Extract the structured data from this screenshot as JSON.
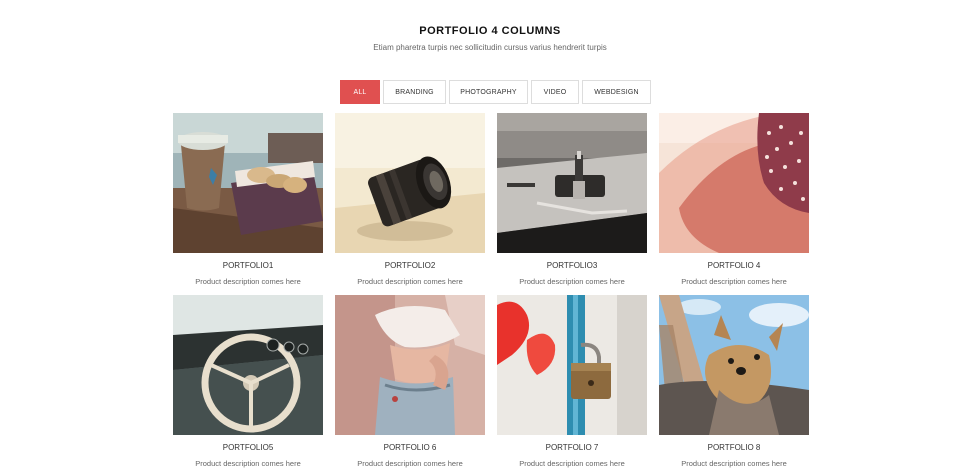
{
  "header": {
    "title": "PORTFOLIO 4 COLUMNS",
    "subtitle": "Etiam pharetra turpis nec sollicitudin cursus varius hendrerit turpis"
  },
  "filters": [
    {
      "label": "ALL",
      "active": true
    },
    {
      "label": "BRANDING",
      "active": false
    },
    {
      "label": "PHOTOGRAPHY",
      "active": false
    },
    {
      "label": "VIDEO",
      "active": false
    },
    {
      "label": "WEBDESIGN",
      "active": false
    }
  ],
  "accent_color": "#e05050",
  "portfolio": [
    {
      "title": "PORTFOLIO1",
      "description": "Product description comes here",
      "image": "coffee-cookies-photo"
    },
    {
      "title": "PORTFOLIO2",
      "description": "Product description comes here",
      "image": "camera-lens-photo"
    },
    {
      "title": "PORTFOLIO3",
      "description": "Product description comes here",
      "image": "turntable-photo"
    },
    {
      "title": "PORTFOLIO 4",
      "description": "Product description comes here",
      "image": "polka-dot-hat-photo"
    },
    {
      "title": "PORTFOLIO5",
      "description": "Product description comes here",
      "image": "steering-wheel-photo"
    },
    {
      "title": "PORTFOLIO 6",
      "description": "Product description comes here",
      "image": "fashion-model-photo"
    },
    {
      "title": "PORTFOLIO 7",
      "description": "Product description comes here",
      "image": "padlock-photo"
    },
    {
      "title": "PORTFOLIO 8",
      "description": "Product description comes here",
      "image": "yorkie-dog-photo"
    }
  ]
}
